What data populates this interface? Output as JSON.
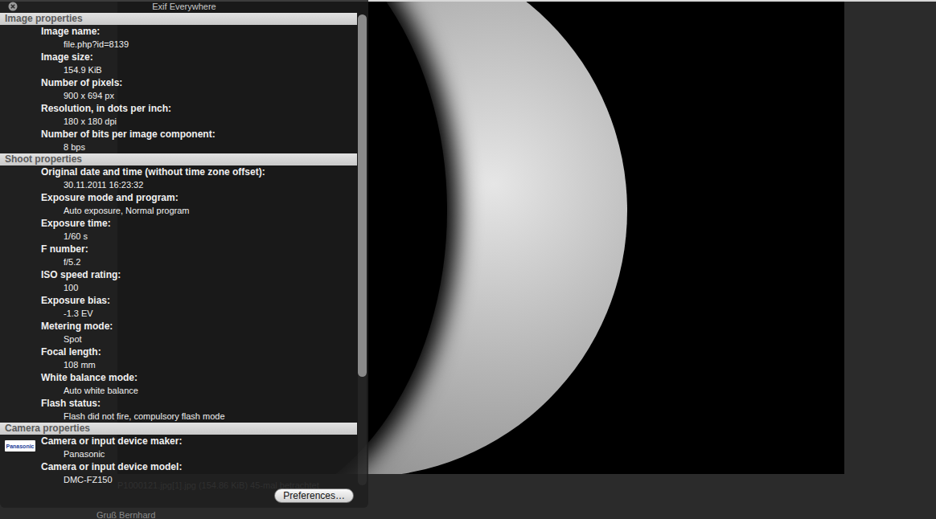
{
  "window": {
    "title": "Exif Everywhere"
  },
  "sections": [
    {
      "title": "Image properties",
      "items": [
        {
          "label": "Image name:",
          "value": "file.php?id=8139"
        },
        {
          "label": "Image size:",
          "value": "154.9 KiB"
        },
        {
          "label": "Number of pixels:",
          "value": "900 x 694 px"
        },
        {
          "label": "Resolution, in dots per inch:",
          "value": "180 x 180 dpi"
        },
        {
          "label": "Number of bits per image component:",
          "value": "8 bps"
        }
      ]
    },
    {
      "title": "Shoot properties",
      "items": [
        {
          "label": "Original date and time (without time zone offset):",
          "value": "30.11.2011 16:23:32"
        },
        {
          "label": "Exposure mode and program:",
          "value": "Auto exposure, Normal program"
        },
        {
          "label": "Exposure time:",
          "value": "1/60 s"
        },
        {
          "label": "F number:",
          "value": "f/5.2"
        },
        {
          "label": "ISO speed rating:",
          "value": "100"
        },
        {
          "label": "Exposure bias:",
          "value": "-1.3 EV"
        },
        {
          "label": "Metering mode:",
          "value": "Spot"
        },
        {
          "label": "Focal length:",
          "value": "108 mm"
        },
        {
          "label": "White balance mode:",
          "value": "Auto white balance"
        },
        {
          "label": "Flash status:",
          "value": "Flash did not fire, compulsory flash mode"
        }
      ]
    },
    {
      "title": "Camera properties",
      "items": [
        {
          "label": "Camera or input device maker:",
          "value": "Panasonic",
          "logo": "Panasonic"
        },
        {
          "label": "Camera or input device model:",
          "value": "DMC-FZ150"
        }
      ]
    }
  ],
  "scrollbar": {
    "level": 0.77
  },
  "buttons": [
    "Preferences…"
  ],
  "background": {
    "caption": "P1000121.jpg[1].jpg (154.86 KiB) 45-mal betrachtet",
    "signature": "Gruß Bernhard"
  }
}
